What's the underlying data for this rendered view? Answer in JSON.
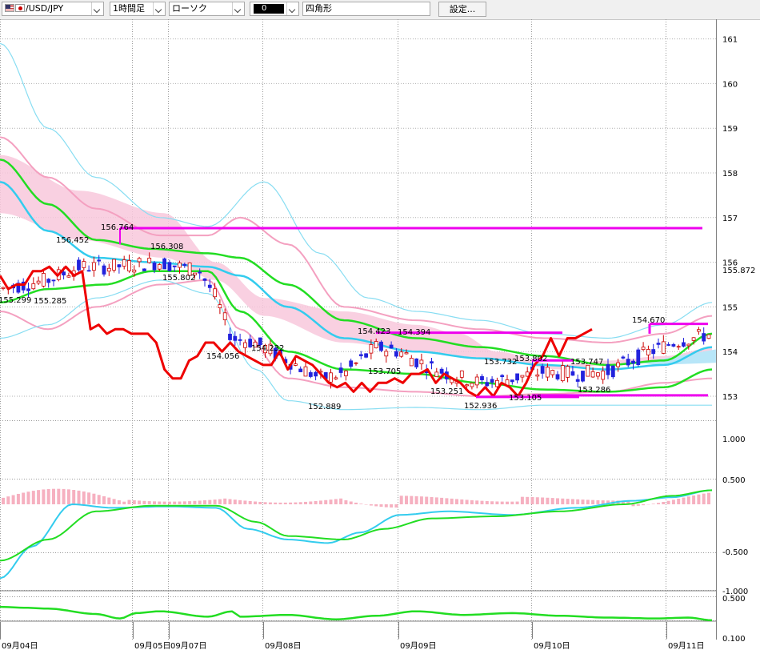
{
  "toolbar": {
    "symbol": "/USD/JPY",
    "timeframe": "1時間足",
    "chart_type": "ローソク",
    "color_value": "0",
    "shape": "四角形",
    "settings_label": "設定..."
  },
  "chart_data": [
    {
      "type": "candlestick",
      "panel": "price",
      "x_labels": [
        "09月04日",
        "09月05日",
        "09月07日",
        "09月08日",
        "09月09日",
        "09月10日",
        "09月11日"
      ],
      "y_ticks": [
        153,
        154,
        155,
        156,
        157,
        158,
        159,
        160,
        161
      ],
      "ylim": [
        152.6,
        161.2
      ],
      "current_price": "155.872",
      "annotations": [
        "155.299",
        "155.285",
        "156.452",
        "156.764",
        "156.308",
        "155.802",
        "154.056",
        "154.232",
        "152.889",
        "154.423",
        "154.394",
        "153.705",
        "153.251",
        "152.936",
        "153.732",
        "153.802",
        "153.747",
        "153.286",
        "153.105",
        "154.670"
      ],
      "horizontal_levels": [
        156.764,
        154.423,
        153.802,
        153.105,
        154.67
      ],
      "series": [
        {
          "name": "",
          "color": "#ee0000",
          "values": [
            155.7,
            155.4,
            155.5,
            155.5,
            155.8,
            155.8,
            155.9,
            155.7,
            155.9,
            155.7,
            155.8,
            154.5,
            154.6,
            154.4,
            154.5,
            154.5,
            154.4,
            154.4,
            154.4,
            154.2,
            153.6,
            153.4,
            153.4,
            153.8,
            153.9,
            154.2,
            154.2,
            154.0,
            154.2,
            154.0,
            153.9,
            153.8,
            153.7,
            153.7,
            154.0,
            153.6,
            153.9,
            153.8,
            153.7,
            153.5,
            153.3,
            153.2,
            153.3,
            153.1,
            153.3,
            153.1,
            153.3,
            153.3,
            153.4,
            153.3,
            153.5,
            153.5,
            153.6,
            153.3,
            153.5,
            153.4,
            153.3,
            153.1,
            153.0,
            153.2,
            153.0,
            153.3,
            153.2,
            153.0,
            153.3,
            153.7,
            153.9,
            154.3,
            153.9,
            154.3,
            154.3,
            154.4,
            154.5
          ]
        }
      ]
    },
    {
      "type": "line",
      "panel": "macd",
      "y_ticks": [
        "1.000",
        "0.500",
        "-0.500",
        "-1.000"
      ]
    },
    {
      "type": "line",
      "panel": "lower",
      "y_ticks": [
        "0.500",
        "0.100"
      ]
    }
  ],
  "colors": {
    "resistance": "#ee00ee",
    "main_line": "#ee0000",
    "ma_green": "#22dd22",
    "ma_cyan": "#33ccee",
    "band_pink": "#f4a0c0",
    "band_cyan": "#88ddf2",
    "cloud": "#f8c8dc",
    "bull_candle": "#ffffff",
    "bear_candle": "#2222dd",
    "hist": "#f6b0c0"
  }
}
